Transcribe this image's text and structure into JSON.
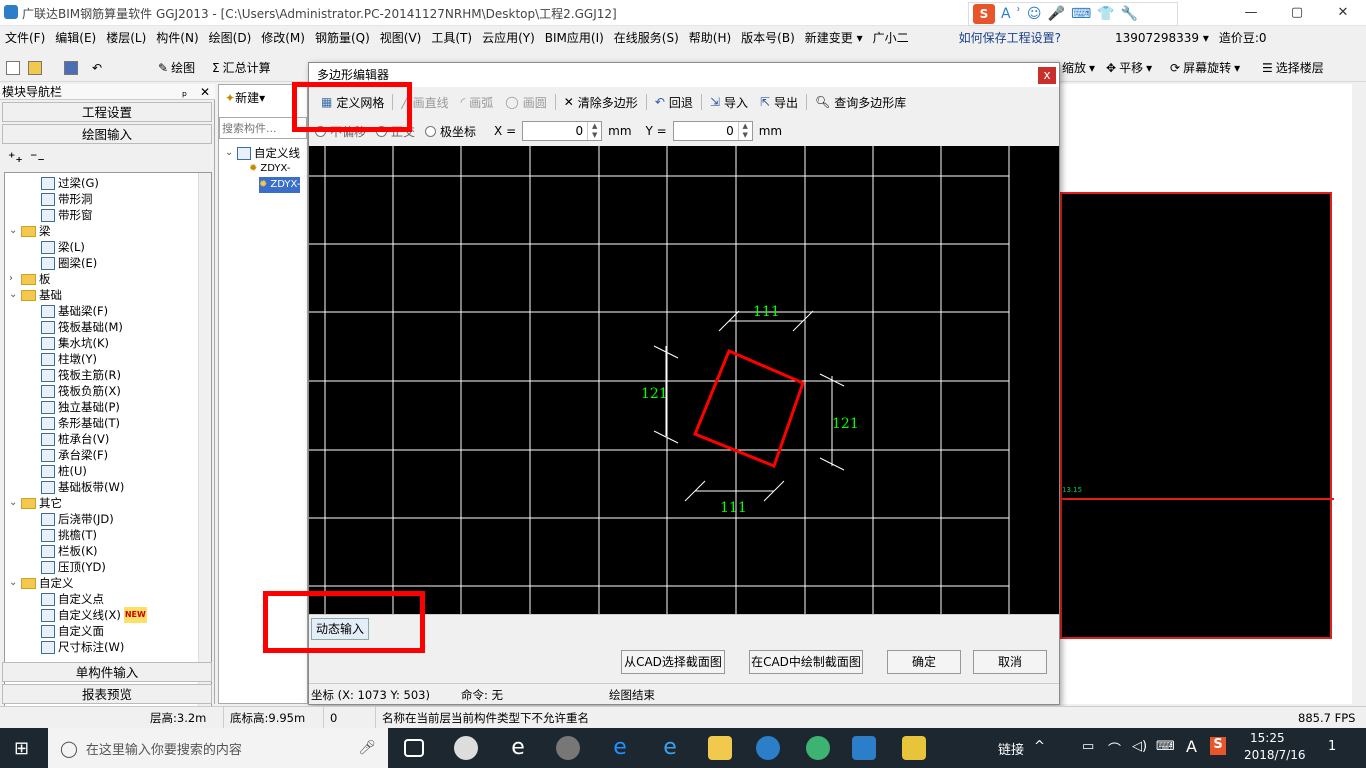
{
  "app": {
    "title": "广联达BIM钢筋算量软件 GGJ2013 - [C:\\Users\\Administrator.PC-20141127NRHM\\Desktop\\工程2.GGJ12]",
    "window_controls": [
      "—",
      "▢",
      "✕"
    ]
  },
  "ime": {
    "s": "S",
    "items": [
      "A",
      "ʾ",
      "☺",
      "🎤",
      "⌨",
      "👕",
      "🔧"
    ]
  },
  "menu": [
    "文件(F)",
    "编辑(E)",
    "楼层(L)",
    "构件(N)",
    "绘图(D)",
    "修改(M)",
    "钢筋量(Q)",
    "视图(V)",
    "工具(T)",
    "云应用(Y)",
    "BIM应用(I)",
    "在线服务(S)",
    "帮助(H)",
    "版本号(B)",
    "新建变更 ▾",
    "广小二",
    "如何保存工程设置?",
    "13907298339 ▾",
    "造价豆:0"
  ],
  "toolbar": {
    "draw": "绘图",
    "sum": "汇总计算",
    "zoom": "缩放",
    "pan": "平移",
    "rotate": "屏幕旋转",
    "select_floor": "选择楼层"
  },
  "left_pane": {
    "title": "模块导航栏",
    "pin": "ₚ",
    "close": "✕",
    "project_settings": "工程设置",
    "draw_input": "绘图输入",
    "single_input": "单构件输入",
    "report_preview": "报表预览",
    "tree": [
      {
        "level": 2,
        "label": "过梁(G)",
        "expand": ""
      },
      {
        "level": 2,
        "label": "带形洞",
        "expand": ""
      },
      {
        "level": 2,
        "label": "带形窗",
        "expand": ""
      },
      {
        "level": 1,
        "label": "梁",
        "expand": "⌄",
        "folder": true
      },
      {
        "level": 2,
        "label": "梁(L)",
        "expand": ""
      },
      {
        "level": 2,
        "label": "圈梁(E)",
        "expand": ""
      },
      {
        "level": 1,
        "label": "板",
        "expand": "›",
        "folder": true
      },
      {
        "level": 1,
        "label": "基础",
        "expand": "⌄",
        "folder": true
      },
      {
        "level": 2,
        "label": "基础梁(F)",
        "expand": ""
      },
      {
        "level": 2,
        "label": "筏板基础(M)",
        "expand": ""
      },
      {
        "level": 2,
        "label": "集水坑(K)",
        "expand": ""
      },
      {
        "level": 2,
        "label": "柱墩(Y)",
        "expand": ""
      },
      {
        "level": 2,
        "label": "筏板主筋(R)",
        "expand": ""
      },
      {
        "level": 2,
        "label": "筏板负筋(X)",
        "expand": ""
      },
      {
        "level": 2,
        "label": "独立基础(P)",
        "expand": ""
      },
      {
        "level": 2,
        "label": "条形基础(T)",
        "expand": ""
      },
      {
        "level": 2,
        "label": "桩承台(V)",
        "expand": ""
      },
      {
        "level": 2,
        "label": "承台梁(F)",
        "expand": ""
      },
      {
        "level": 2,
        "label": "桩(U)",
        "expand": ""
      },
      {
        "level": 2,
        "label": "基础板带(W)",
        "expand": ""
      },
      {
        "level": 1,
        "label": "其它",
        "expand": "⌄",
        "folder": true
      },
      {
        "level": 2,
        "label": "后浇带(JD)",
        "expand": ""
      },
      {
        "level": 2,
        "label": "挑檐(T)",
        "expand": ""
      },
      {
        "level": 2,
        "label": "栏板(K)",
        "expand": ""
      },
      {
        "level": 2,
        "label": "压顶(YD)",
        "expand": ""
      },
      {
        "level": 1,
        "label": "自定义",
        "expand": "⌄",
        "folder": true
      },
      {
        "level": 2,
        "label": "自定义点",
        "expand": ""
      },
      {
        "level": 2,
        "label": "自定义线(X)",
        "expand": "",
        "badge": "NEW"
      },
      {
        "level": 2,
        "label": "自定义面",
        "expand": ""
      },
      {
        "level": 2,
        "label": "尺寸标注(W)",
        "expand": ""
      }
    ]
  },
  "mid_pane": {
    "new": "新建",
    "search_placeholder": "搜索构件...",
    "root": "自定义线",
    "items": [
      "ZDYX-",
      "ZDYX-"
    ]
  },
  "dialog": {
    "title": "多边形编辑器",
    "close": "x",
    "tools": {
      "define_grid": "定义网格",
      "draw_line": "画直线",
      "draw_arc": "画弧",
      "draw_circle": "画圆",
      "clear": "清除多边形",
      "undo": "回退",
      "import": "导入",
      "export": "导出",
      "query_lib": "查询多边形库"
    },
    "coords": {
      "ortho": "不偏移",
      "orthogonal": "正交",
      "polar": "极坐标",
      "x_label": "X =",
      "x_value": "0",
      "y_label": "Y =",
      "y_value": "0",
      "unit": "mm"
    },
    "dims": {
      "top": "111",
      "bottom": "111",
      "left": "121",
      "right": "121"
    },
    "dynamic_input": "动态输入",
    "buttons": {
      "cad_select": "从CAD选择截面图",
      "cad_draw": "在CAD中绘制截面图",
      "ok": "确定",
      "cancel": "取消"
    },
    "status": {
      "coord": "坐标 (X: 1073 Y: 503)",
      "command": "命令: 无",
      "state": "绘图结束"
    }
  },
  "canvas_label": "13.15",
  "statusbar": {
    "floor_height": "层高:3.2m",
    "base_height": "底标高:9.95m",
    "zero": "0",
    "message": "名称在当前层当前构件类型下不允许重名",
    "fps": "885.7 FPS"
  },
  "taskbar": {
    "search_placeholder": "在这里输入你要搜索的内容",
    "link": "链接",
    "lang": "A",
    "time": "15:25",
    "date": "2018/7/16",
    "notify": "1"
  },
  "colors": {
    "highlight": "#ff0000",
    "polygon": "#ff0000",
    "dim_text": "#00ff00",
    "grid_line": "#ffffff"
  }
}
